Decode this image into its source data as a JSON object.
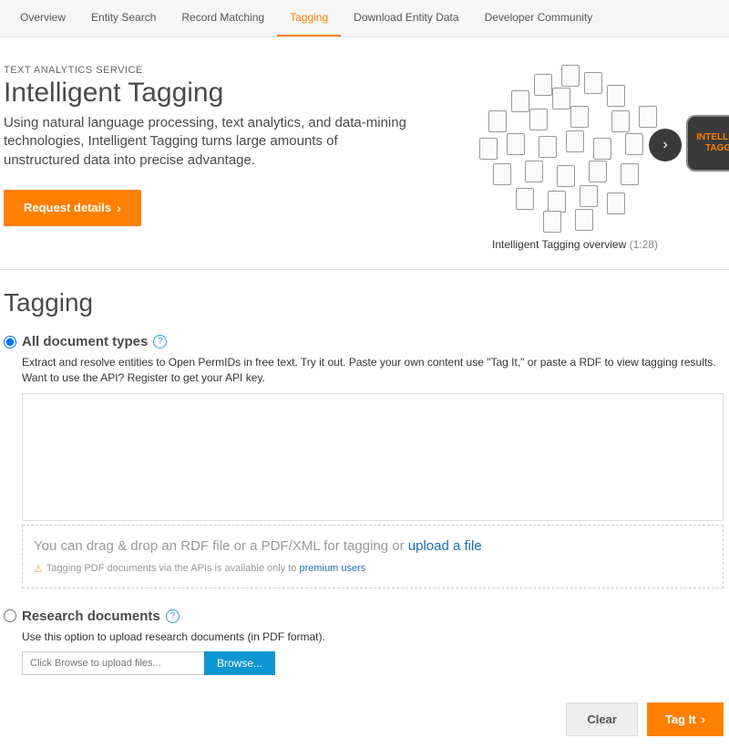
{
  "nav": {
    "items": [
      {
        "label": "Overview"
      },
      {
        "label": "Entity Search"
      },
      {
        "label": "Record Matching"
      },
      {
        "label": "Tagging"
      },
      {
        "label": "Download Entity Data"
      },
      {
        "label": "Developer Community"
      }
    ],
    "active_index": 3
  },
  "hero": {
    "eyebrow": "TEXT ANALYTICS SERVICE",
    "title": "Intelligent Tagging",
    "description": "Using natural language processing, text analytics, and data-mining technologies, Intelligent Tagging turns large amounts of unstructured data into precise advantage.",
    "cta": "Request details",
    "video": {
      "caption_prefix": "Intelligent Tagging overview",
      "duration": "(1:28)",
      "box_text_1": "INTELLIGENT",
      "box_text_2": "TAGGING"
    }
  },
  "section_title": "Tagging",
  "all_docs": {
    "title": "All document types",
    "description": "Extract and resolve entities to Open PermIDs in free text. Try it out. Paste your own content use \"Tag It,\" or paste a RDF to view tagging results. Want to use the API? Register to get your API key.",
    "dropzone_text": "You can drag & drop an RDF file or a PDF/XML for tagging or ",
    "upload_link": "upload a file",
    "note_prefix": "Tagging PDF documents via the APIs is available only to ",
    "note_link": "premium users"
  },
  "research": {
    "title": "Research documents",
    "description": "Use this option to upload research documents (in PDF format).",
    "placeholder": "Click Browse to upload files...",
    "browse": "Browse..."
  },
  "actions": {
    "clear": "Clear",
    "tagit": "Tag It"
  }
}
